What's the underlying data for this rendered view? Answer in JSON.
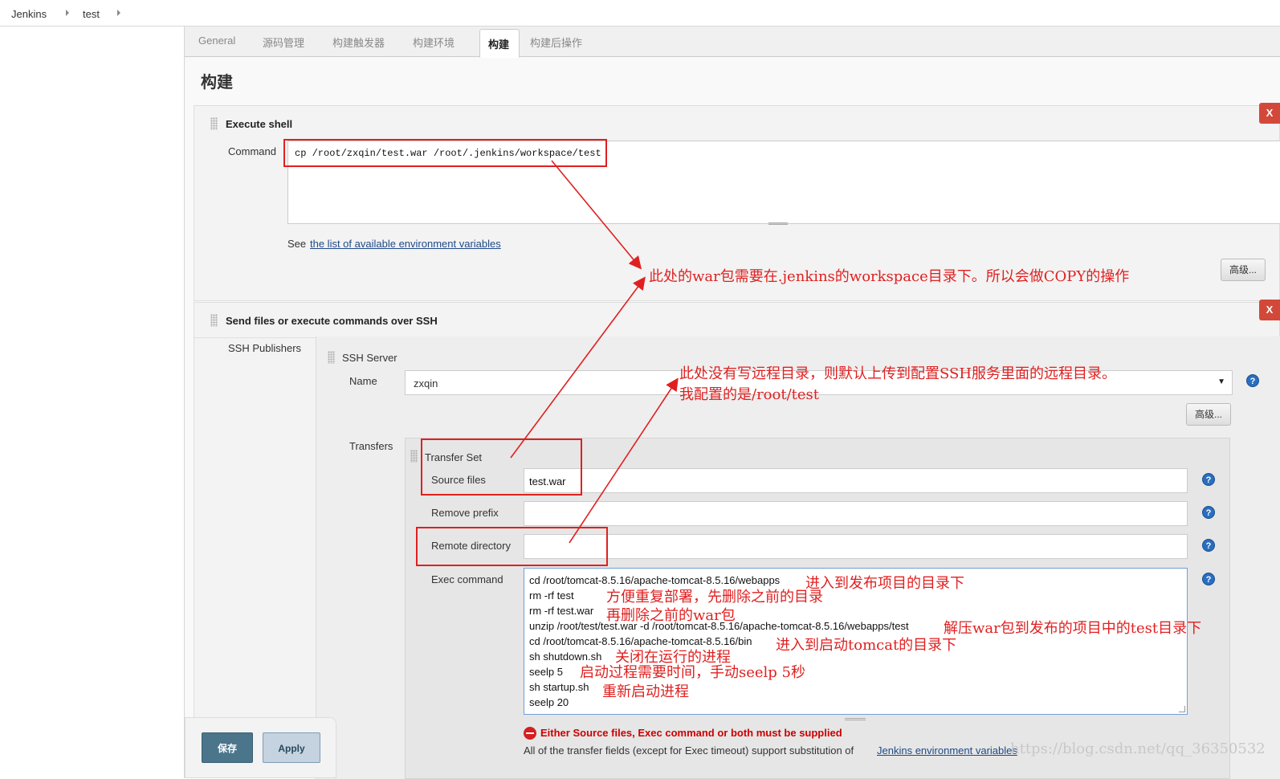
{
  "breadcrumb": {
    "items": [
      "Jenkins",
      "test"
    ]
  },
  "tabs": [
    "General",
    "源码管理",
    "构建触发器",
    "构建环境",
    "构建",
    "构建后操作"
  ],
  "section_title": "构建",
  "execute_shell": {
    "title": "Execute shell",
    "delete_label": "X",
    "command_label": "Command",
    "command_value": "cp /root/zxqin/test.war /root/.jenkins/workspace/test",
    "see_prefix": "See",
    "env_link": "the list of available environment variables",
    "advanced_label": "高级..."
  },
  "ssh_step": {
    "title": "Send files or execute commands over SSH",
    "delete_label": "X",
    "publishers_label": "SSH Publishers",
    "server_title": "SSH Server",
    "name_label": "Name",
    "name_value": "zxqin",
    "server_advanced_label": "高级...",
    "transfers_label": "Transfers",
    "transfer_set_title": "Transfer Set",
    "source_files_label": "Source files",
    "source_files_value": "test.war",
    "remove_prefix_label": "Remove prefix",
    "remove_prefix_value": "",
    "remote_directory_label": "Remote directory",
    "remote_directory_value": "",
    "exec_command_label": "Exec command",
    "exec_lines": [
      "cd /root/tomcat-8.5.16/apache-tomcat-8.5.16/webapps",
      "rm -rf test",
      "rm -rf test.war",
      "unzip /root/test/test.war -d /root/tomcat-8.5.16/apache-tomcat-8.5.16/webapps/test",
      "cd /root/tomcat-8.5.16/apache-tomcat-8.5.16/bin",
      "sh shutdown.sh",
      "seelp 5",
      "sh startup.sh",
      "seelp 20"
    ],
    "error_text": "Either Source files, Exec command or both must be supplied",
    "substitution_prefix": "All of the transfer fields (except for Exec timeout) support substitution of",
    "substitution_link": "Jenkins environment variables"
  },
  "annotations": {
    "war_note": "此处的war包需要在.jenkins的workspace目录下。所以会做COPY的操作",
    "remote_note_line1": "此处没有写远程目录，则默认上传到配置SSH服务里面的远程目录。",
    "remote_note_line2": "我配置的是/root/test",
    "exec_notes": [
      "进入到发布项目的目录下",
      "方便重复部署，先删除之前的目录",
      "再删除之前的war包",
      "解压war包到发布的项目中的test目录下",
      "进入到启动tomcat的目录下",
      "关闭在运行的进程",
      "启动过程需要时间，手动seelp 5秒",
      "重新启动进程"
    ]
  },
  "buttons": {
    "save": "保存",
    "apply": "Apply"
  },
  "watermark": "https://blog.csdn.net/qq_36350532",
  "colors": {
    "annotation_red": "#e02020",
    "delete_red": "#d24939",
    "link_blue": "#204a87",
    "save_blue": "#4b758b"
  }
}
